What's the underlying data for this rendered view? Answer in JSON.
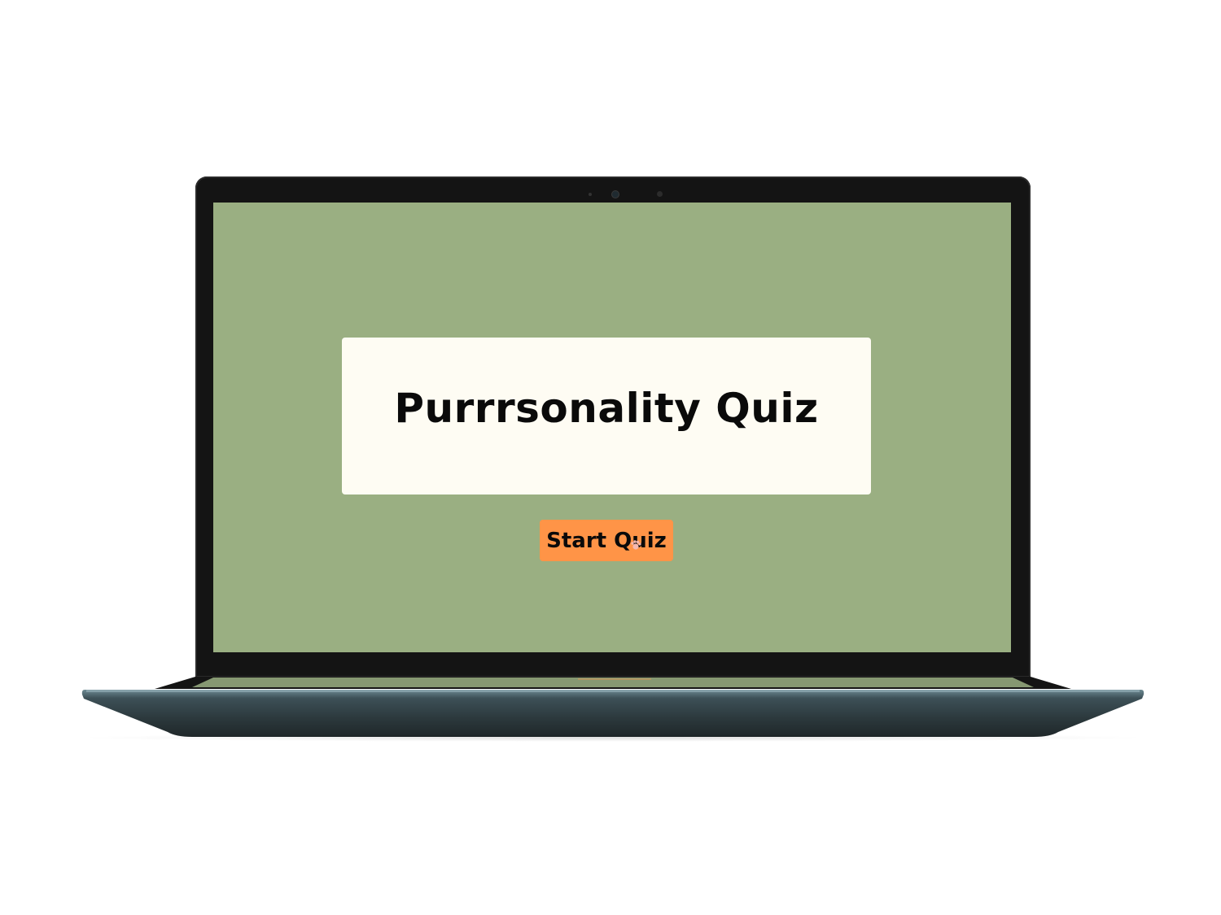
{
  "app": {
    "title": "Purrrsonality Quiz",
    "start_button_label": "Start Quiz"
  },
  "colors": {
    "screen_background": "#9aaf82",
    "card_background": "#fefcf3",
    "button_background": "#ff9447",
    "text": "#0a0a0a",
    "bezel": "#141414",
    "laptop_base": "#2f3d42"
  },
  "icons": {
    "cursor": "paw-cursor-icon"
  }
}
